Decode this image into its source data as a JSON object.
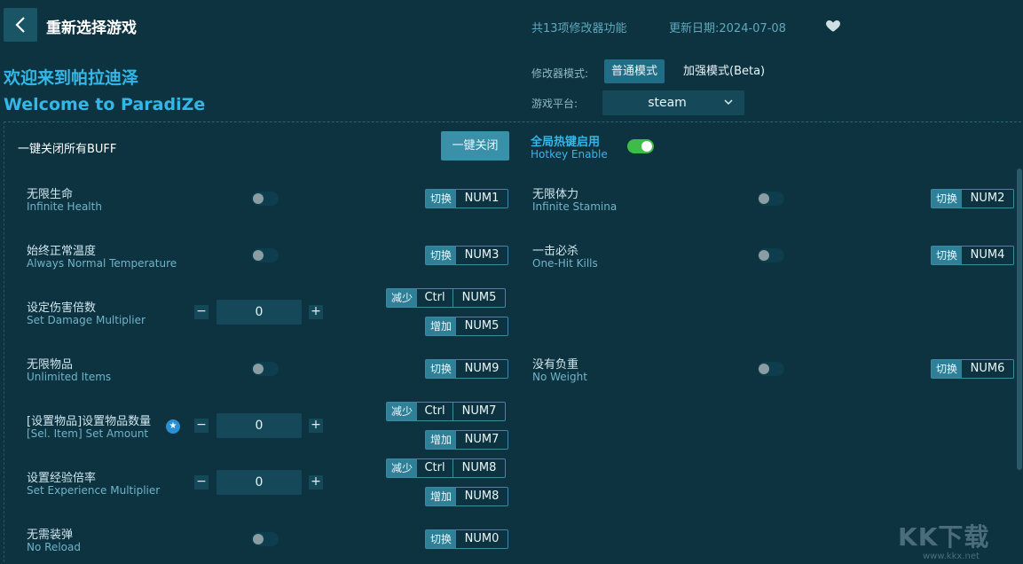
{
  "header": {
    "title": "重新选择游戏",
    "features_count": "共13项修改器功能",
    "update_date": "更新日期:2024-07-08"
  },
  "welcome": {
    "cn": "欢迎来到帕拉迪泽",
    "en": "Welcome to ParadiZe"
  },
  "mode": {
    "label": "修改器模式:",
    "normal": "普通模式",
    "enhanced": "加强模式(Beta)"
  },
  "platform": {
    "label": "游戏平台:",
    "value": "steam"
  },
  "panel": {
    "buff_title": "一键关闭所有BUFF",
    "close_all": "一键关闭",
    "hotkey_cn": "全局热键启用",
    "hotkey_en": "Hotkey Enable",
    "hotkey_enabled": true
  },
  "labels": {
    "switch": "切换",
    "decrease": "减少",
    "increase": "增加",
    "minus": "−",
    "plus": "+",
    "ctrl": "Ctrl"
  },
  "cheats": {
    "infinite_health": {
      "cn": "无限生命",
      "en": "Infinite Health",
      "key": "NUM1"
    },
    "normal_temp": {
      "cn": "始终正常温度",
      "en": "Always Normal Temperature",
      "key": "NUM3"
    },
    "damage_mult": {
      "cn": "设定伤害倍数",
      "en": "Set Damage Multiplier",
      "value": "0",
      "dec_key": "NUM5",
      "inc_key": "NUM5"
    },
    "unlimited_items": {
      "cn": "无限物品",
      "en": "Unlimited Items",
      "key": "NUM9"
    },
    "item_amount": {
      "cn": "[设置物品]设置物品数量",
      "en": "[Sel. Item] Set Amount",
      "value": "0",
      "dec_key": "NUM7",
      "inc_key": "NUM7"
    },
    "exp_mult": {
      "cn": "设置经验倍率",
      "en": "Set Experience Multiplier",
      "value": "0",
      "dec_key": "NUM8",
      "inc_key": "NUM8"
    },
    "no_reload": {
      "cn": "无需装弹",
      "en": "No Reload",
      "key": "NUM0"
    },
    "infinite_stamina": {
      "cn": "无限体力",
      "en": "Infinite Stamina",
      "key": "NUM2"
    },
    "one_hit_kills": {
      "cn": "一击必杀",
      "en": "One-Hit Kills",
      "key": "NUM4"
    },
    "no_weight": {
      "cn": "没有负重",
      "en": "No Weight",
      "key": "NUM6"
    }
  },
  "watermark": {
    "logo": "KK下载",
    "url": "www.kkx.net"
  },
  "colors": {
    "background": "#0d3340",
    "accent": "#33b7e8",
    "switch_on": "#3dbd47",
    "button": "#3a90a8"
  }
}
